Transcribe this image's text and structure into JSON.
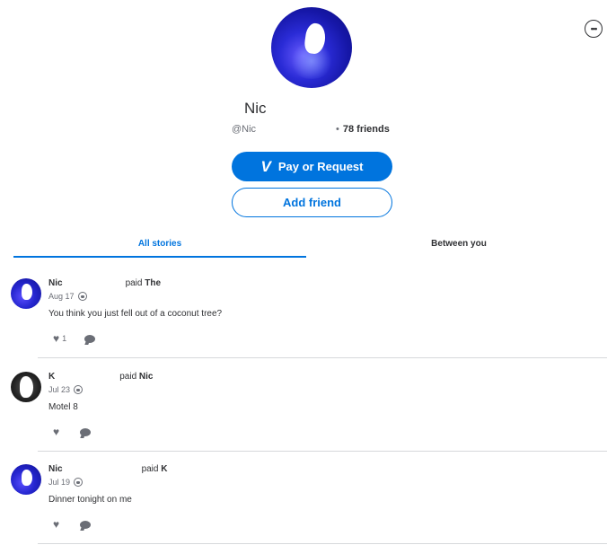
{
  "profile": {
    "name": "Nic",
    "handle": "@Nic",
    "friends_sep": "•",
    "friends_count": "78 friends"
  },
  "actions": {
    "pay_label": "Pay or Request",
    "pay_logo": "V",
    "add_friend_label": "Add friend",
    "more_label": "•••"
  },
  "tabs": {
    "all_stories": "All stories",
    "between_you": "Between you"
  },
  "stories": [
    {
      "payer": "Nic",
      "verb": "paid",
      "payee": "The",
      "date": "Aug 17",
      "note": "You think you just fell out of a coconut tree?",
      "likes": "1"
    },
    {
      "payer": "K",
      "verb": "paid",
      "payee": "Nic",
      "date": "Jul 23",
      "note": "Motel 8",
      "likes": ""
    },
    {
      "payer": "Nic",
      "verb": "paid",
      "payee": "K",
      "date": "Jul 19",
      "note": "Dinner tonight on me",
      "likes": ""
    }
  ],
  "colors": {
    "accent": "#0074de",
    "text": "#2f3033",
    "muted": "#6b6e76",
    "divider": "#d6d8db"
  },
  "icons": {
    "more": "more-icon",
    "venmo": "venmo-logo-icon",
    "globe": "globe-icon",
    "heart": "heart-icon",
    "comment": "comment-icon"
  }
}
